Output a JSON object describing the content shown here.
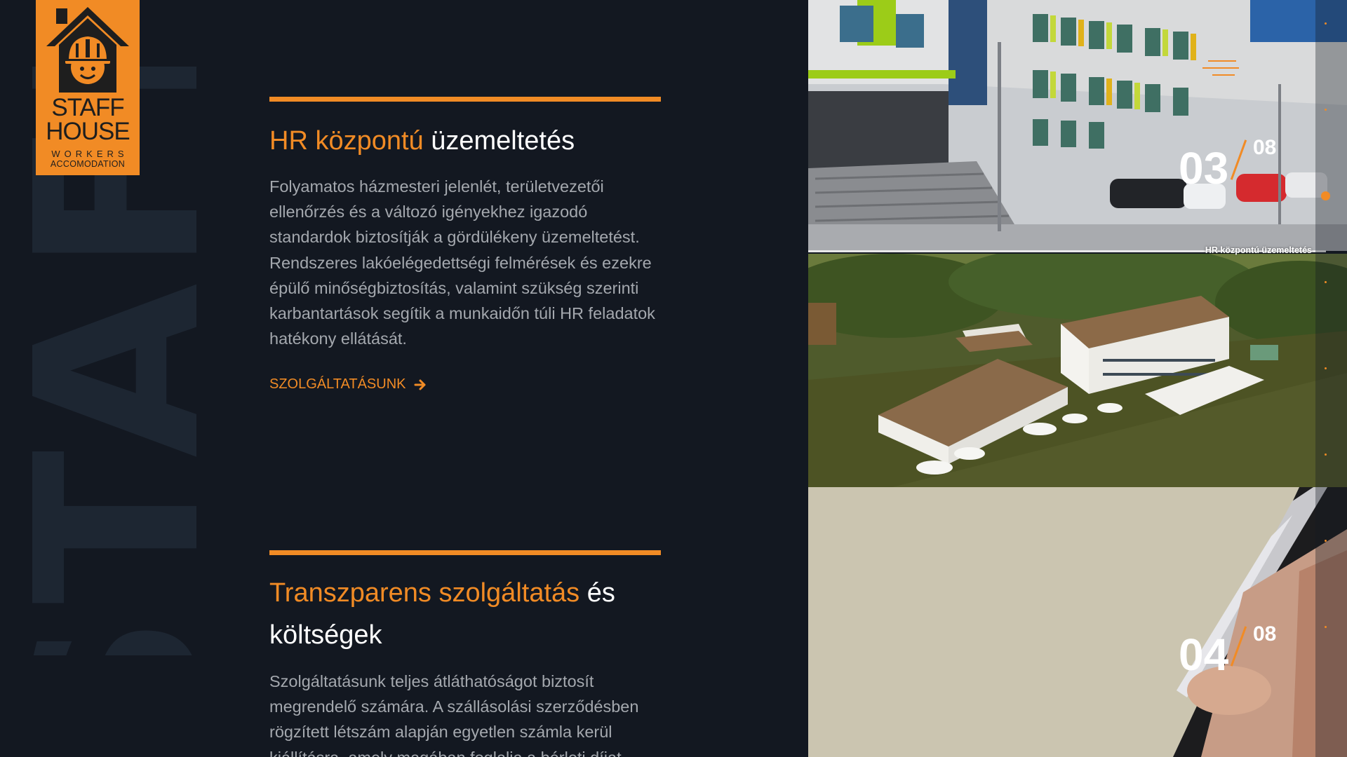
{
  "brand": {
    "watermark": "STAFF",
    "logo_line1": "STAFF",
    "logo_line2": "HOUSE",
    "logo_line3": "WORKERS",
    "logo_line4": "ACCOMODATION",
    "accent_color": "#f18b25",
    "background_color": "#131821"
  },
  "sections": [
    {
      "title_accent": "HR központú",
      "title_rest": " üzemeltetés",
      "body": "Folyamatos házmesteri jelenlét, területvezetői ellenőrzés és a változó igényekhez igazodó standardok biztosítják a gördülékeny üzemeltetést. Rendszeres lakóelégedettségi felmérések és ezekre épülő minőségbiztosítás, valamint szükség szerinti karbantartások segítik a munkaidőn túli HR feladatok hatékony ellátását.",
      "cta_label": "SZOLGÁLTATÁSUNK",
      "cta_icon": "arrow-right-icon"
    },
    {
      "title_accent": "Transzparens szolgáltatás",
      "title_rest": " és költségek",
      "body": "Szolgáltatásunk teljes átláthatóságot biztosít megrendelő számára. A szállásolási szerződésben rögzített létszám alapján egyetlen számla kerül kiállításra, amely magában foglalja a bérleti díjat"
    }
  ],
  "slides": {
    "current_a": "03",
    "total_a": "08",
    "current_b": "04",
    "total_b": "08",
    "active_label": "HR központú üzemeltetés",
    "indicator_count": 8,
    "active_index": 3
  },
  "menu": {
    "icon": "hamburger-menu-icon"
  }
}
